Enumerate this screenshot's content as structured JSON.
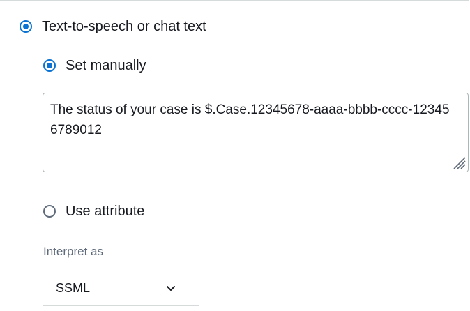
{
  "prompt_type": {
    "tts_option": {
      "label": "Text-to-speech or chat text",
      "selected": true
    },
    "entry_mode": {
      "manual_option": {
        "label": "Set manually",
        "selected": true
      },
      "attribute_option": {
        "label": "Use attribute",
        "selected": false
      }
    },
    "message_text": "The status of your case is $.Case.12345678-aaaa-bbbb-cccc-123456789012",
    "interpret_as": {
      "label": "Interpret as",
      "selected_value": "SSML"
    }
  },
  "colors": {
    "accent": "#0972d3",
    "text": "#16191f",
    "muted_text": "#5f6b7a",
    "border": "#aab7b8"
  },
  "icons": {
    "radio_selected": "radio-selected-icon",
    "radio_unselected": "radio-unselected-icon",
    "resize": "resize-handle-icon",
    "dropdown": "chevron-down-icon"
  }
}
